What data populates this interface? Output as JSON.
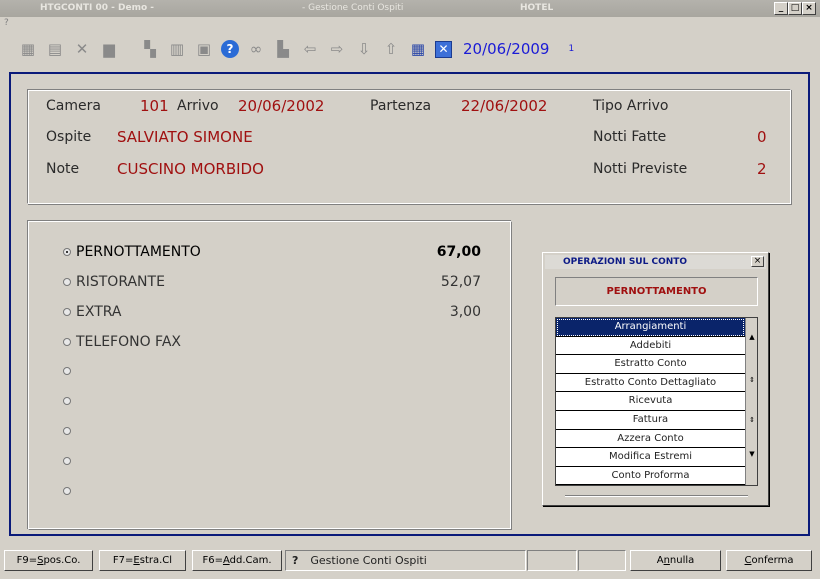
{
  "window": {
    "title_app": "HTGCONTI 00 - Demo -",
    "title_module": "- Gestione Conti Ospiti",
    "title_hotel": "HOTEL",
    "menu": "?"
  },
  "toolbar": {
    "icons": [
      "table-icon",
      "table-copy-icon",
      "delete-icon",
      "print-icon",
      "nodes-icon",
      "form-icon",
      "image-icon",
      "help-icon",
      "binoculars-icon",
      "bar-icon",
      "arrow-left-icon",
      "arrow-right-icon",
      "arrow-down-icon",
      "arrow-up-icon",
      "calculator-icon",
      "close-icon"
    ],
    "date": "20/06/2009",
    "counter": "1"
  },
  "guest": {
    "camera_label": "Camera",
    "camera": "101",
    "arrivo_label": "Arrivo",
    "arrivo": "20/06/2002",
    "partenza_label": "Partenza",
    "partenza": "22/06/2002",
    "tipo_arrivo_label": "Tipo Arrivo",
    "ospite_label": "Ospite",
    "ospite": "SALVIATO SIMONE",
    "notti_fatte_label": "Notti Fatte",
    "notti_fatte": "0",
    "note_label": "Note",
    "note": "CUSCINO MORBIDO",
    "notti_previste_label": "Notti Previste",
    "notti_previste": "2"
  },
  "services": [
    {
      "label": "PERNOTTAMENTO",
      "amount": "67,00",
      "selected": true
    },
    {
      "label": "RISTORANTE",
      "amount": "52,07",
      "selected": false
    },
    {
      "label": "EXTRA",
      "amount": "3,00",
      "selected": false
    },
    {
      "label": "TELEFONO FAX",
      "amount": "",
      "selected": false
    },
    {
      "label": "",
      "amount": "",
      "selected": false
    },
    {
      "label": "",
      "amount": "",
      "selected": false
    },
    {
      "label": "",
      "amount": "",
      "selected": false
    },
    {
      "label": "",
      "amount": "",
      "selected": false
    },
    {
      "label": "",
      "amount": "",
      "selected": false
    }
  ],
  "operations": {
    "title": "OPERAZIONI SUL CONTO",
    "current": "PERNOTTAMENTO",
    "items": [
      "Arrangiamenti",
      "Addebiti",
      "Estratto Conto",
      "Estratto Conto Dettagliato",
      "Ricevuta",
      "Fattura",
      "Azzera Conto",
      "Modifica Estremi",
      "Conto Proforma"
    ],
    "selected_index": 0
  },
  "statusbar": {
    "btn_spos_pre": "F9=",
    "btn_spos_key": "S",
    "btn_spos_post": "pos.Co.",
    "btn_estra_pre": "F7=",
    "btn_estra_key": "E",
    "btn_estra_post": "stra.Cl",
    "btn_add_pre": "F6=",
    "btn_add_key": "A",
    "btn_add_post": "dd.Cam.",
    "help": "?",
    "message": "Gestione Conti Ospiti",
    "annulla_pre": "A",
    "annulla_key": "n",
    "annulla_post": "nulla",
    "conferma_pre": "",
    "conferma_key": "C",
    "conferma_post": "onferma"
  }
}
